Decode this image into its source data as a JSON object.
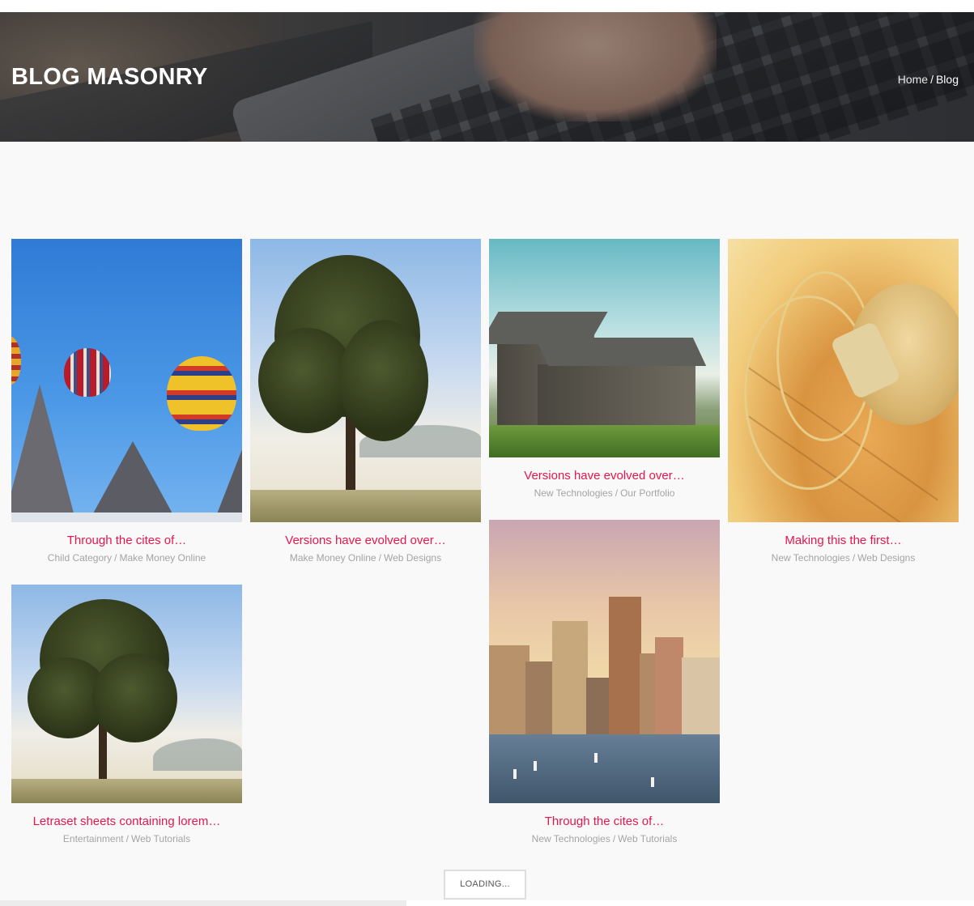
{
  "header": {
    "title": "BLOG MASONRY",
    "breadcrumb": {
      "home": "Home",
      "separator": "/",
      "current": "Blog"
    }
  },
  "posts": [
    {
      "title": "Through the cites of…",
      "categories": [
        "Child Category",
        "Make Money Online"
      ],
      "image": "hot-air-balloons"
    },
    {
      "title": "Versions have evolved over…",
      "categories": [
        "Make Money Online",
        "Web Designs"
      ],
      "image": "tree-in-field"
    },
    {
      "title": "Versions have evolved over…",
      "categories": [
        "New Technologies",
        "Our Portfolio"
      ],
      "image": "old-wooden-house"
    },
    {
      "title": "Making this the first…",
      "categories": [
        "New Technologies",
        "Web Designs"
      ],
      "image": "headphones-on-wood"
    },
    {
      "title": "Letraset sheets containing lorem…",
      "categories": [
        "Entertainment",
        "Web Tutorials"
      ],
      "image": "tree-in-field"
    },
    {
      "title": "Through the cites of…",
      "categories": [
        "New Technologies",
        "Web Tutorials"
      ],
      "image": "city-harbor"
    }
  ],
  "meta_separator": "/",
  "load_more": {
    "label": "LOADING..."
  },
  "colors": {
    "accent": "#e6164d",
    "meta": "#a4a4a4",
    "page_background": "#f9f9f9"
  }
}
